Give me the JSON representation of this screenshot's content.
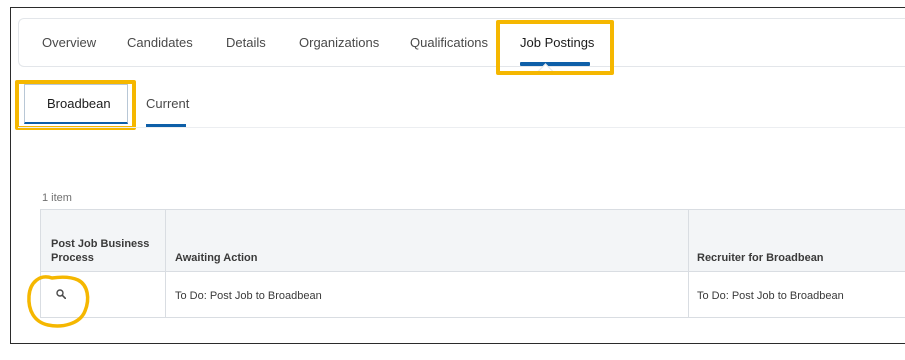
{
  "tabs": [
    {
      "label": "Overview"
    },
    {
      "label": "Candidates"
    },
    {
      "label": "Details"
    },
    {
      "label": "Organizations"
    },
    {
      "label": "Qualifications"
    },
    {
      "label": "Job Postings",
      "active": true
    }
  ],
  "subtabs": [
    {
      "label": "Broadbean",
      "active": true
    },
    {
      "label": "Current"
    }
  ],
  "grid": {
    "count": "1 item",
    "columns": [
      "Post Job Business Process",
      "Awaiting Action",
      "Recruiter for Broadbean"
    ],
    "rows": [
      {
        "icon": "search-icon",
        "awaiting_action": "To Do: Post Job to Broadbean",
        "recruiter": "To Do: Post Job to Broadbean"
      }
    ]
  },
  "colors": {
    "accent": "#0e5fa8",
    "highlight": "#f5b700"
  }
}
